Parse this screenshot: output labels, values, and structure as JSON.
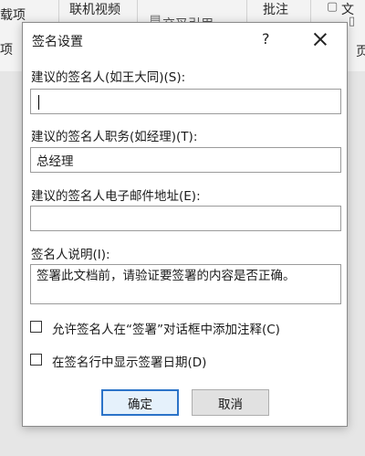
{
  "ribbon": {
    "items": [
      "载项",
      "联机视频",
      "交叉引用",
      "批注",
      "页"
    ],
    "left_fragment": "项",
    "right_fragment": "页码",
    "top_right": "文"
  },
  "dialog": {
    "title": "签名设置",
    "help_glyph": "?",
    "fields": {
      "signer_name_label": "建议的签名人(如王大同)(S):",
      "signer_name_value": "",
      "signer_title_label": "建议的签名人职务(如经理)(T):",
      "signer_title_value": "总经理",
      "signer_email_label": "建议的签名人电子邮件地址(E):",
      "signer_email_value": "",
      "instructions_label": "签名人说明(I):",
      "instructions_value": "签署此文档前，请验证要签署的内容是否正确。"
    },
    "checkboxes": {
      "allow_comments": {
        "label": "允许签名人在“签署”对话框中添加注释(C)",
        "checked": false
      },
      "show_date": {
        "label": "在签名行中显示签署日期(D)",
        "checked": false
      }
    },
    "buttons": {
      "ok": "确定",
      "cancel": "取消"
    }
  }
}
